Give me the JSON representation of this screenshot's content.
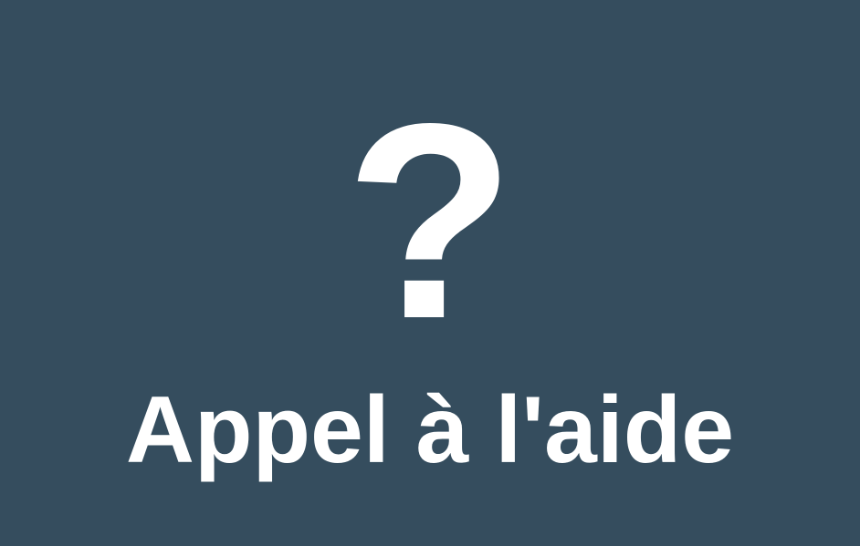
{
  "icon": {
    "name": "question-mark-icon",
    "glyph": "?"
  },
  "title": "Appel à l'aide",
  "colors": {
    "background": "#354d5e",
    "foreground": "#ffffff"
  }
}
